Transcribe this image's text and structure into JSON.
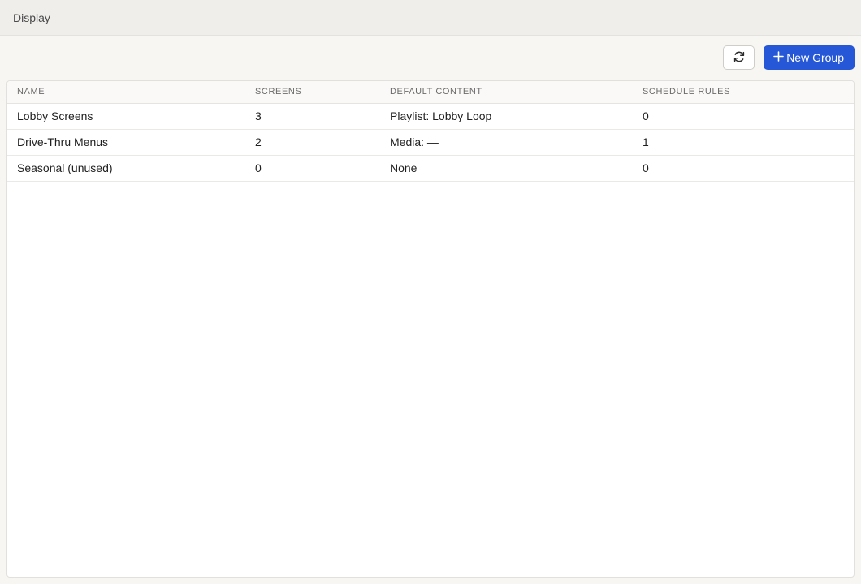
{
  "header": {
    "title": "Display"
  },
  "toolbar": {
    "refresh_icon": "refresh-icon",
    "new_group_label": "New Group",
    "plus_icon": "plus-icon",
    "accent_color": "#2557d6"
  },
  "table": {
    "columns": [
      "NAME",
      "SCREENS",
      "DEFAULT CONTENT",
      "SCHEDULE RULES"
    ],
    "rows": [
      [
        "Lobby Screens",
        "3",
        "Playlist: Lobby Loop",
        "0"
      ],
      [
        "Drive-Thru Menus",
        "2",
        "Media: —",
        "1"
      ],
      [
        "Seasonal (unused)",
        "0",
        "None",
        "0"
      ]
    ]
  }
}
